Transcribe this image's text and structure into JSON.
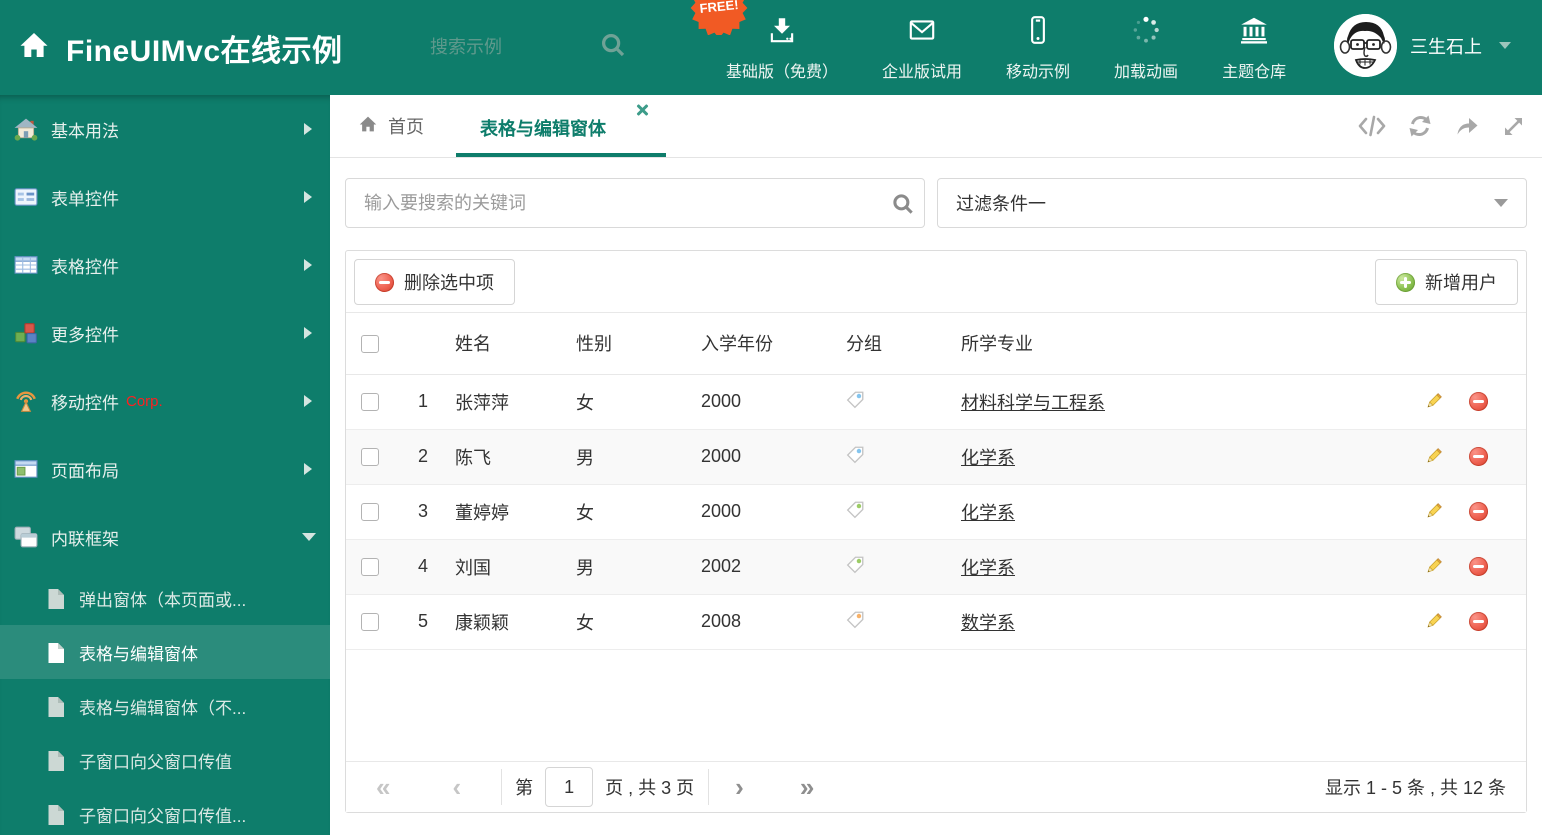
{
  "theme": {
    "accent": "#0e7d6b",
    "sidebar_selected": "#2b8c7c",
    "free_badge_color": "#f15a24",
    "delete_red": "#ee6151",
    "add_green": "#8cc152"
  },
  "header": {
    "logo_title": "FineUIMvc在线示例",
    "search_placeholder": "搜索示例",
    "free_badge": "FREE!",
    "nav_items": [
      {
        "label": "基础版（免费）",
        "icon": "download-icon"
      },
      {
        "label": "企业版试用",
        "icon": "envelope-icon"
      },
      {
        "label": "移动示例",
        "icon": "phone-icon"
      },
      {
        "label": "加载动画",
        "icon": "spinner-icon"
      },
      {
        "label": "主题仓库",
        "icon": "bank-icon"
      }
    ],
    "user": {
      "name": "三生石上"
    }
  },
  "sidebar": {
    "items": [
      {
        "label": "基本用法",
        "icon": "house-icon"
      },
      {
        "label": "表单控件",
        "icon": "form-icon"
      },
      {
        "label": "表格控件",
        "icon": "table-icon"
      },
      {
        "label": "更多控件",
        "icon": "cubes-icon"
      },
      {
        "label": "移动控件",
        "badge": "Corp.",
        "icon": "antenna-icon"
      },
      {
        "label": "页面布局",
        "icon": "layout-icon"
      },
      {
        "label": "内联框架",
        "icon": "frames-icon"
      }
    ],
    "subitems": [
      {
        "label": "弹出窗体（本页面或..."
      },
      {
        "label": "表格与编辑窗体",
        "selected": true
      },
      {
        "label": "表格与编辑窗体（不..."
      },
      {
        "label": "子窗口向父窗口传值"
      },
      {
        "label": "子窗口向父窗口传值..."
      }
    ]
  },
  "tabs": {
    "home": "首页",
    "active": "表格与编辑窗体"
  },
  "filters": {
    "search_placeholder": "输入要搜索的关键词",
    "filter_value": "过滤条件一"
  },
  "grid": {
    "delete_button": "删除选中项",
    "add_button": "新增用户",
    "columns": {
      "name": "姓名",
      "gender": "性别",
      "year": "入学年份",
      "group": "分组",
      "major": "所学专业"
    },
    "tag_colors": {
      "blue": "#85c5ee",
      "green": "#9ccc66",
      "orange": "#f7b26a"
    },
    "rows": [
      {
        "num": "1",
        "name": "张萍萍",
        "gender": "女",
        "year": "2000",
        "tag": "blue",
        "major": "材料科学与工程系"
      },
      {
        "num": "2",
        "name": "陈飞",
        "gender": "男",
        "year": "2000",
        "tag": "blue",
        "major": "化学系"
      },
      {
        "num": "3",
        "name": "董婷婷",
        "gender": "女",
        "year": "2000",
        "tag": "green",
        "major": "化学系"
      },
      {
        "num": "4",
        "name": "刘国",
        "gender": "男",
        "year": "2002",
        "tag": "green",
        "major": "化学系"
      },
      {
        "num": "5",
        "name": "康颖颖",
        "gender": "女",
        "year": "2008",
        "tag": "orange",
        "major": "数学系"
      }
    ],
    "pager": {
      "first": "«",
      "prev": "‹",
      "next": "›",
      "last": "»",
      "page_label_before": "第",
      "page_value": "1",
      "page_label_after": "页 , 共 3 页",
      "summary": "显示 1 - 5 条 , 共 12 条"
    }
  }
}
